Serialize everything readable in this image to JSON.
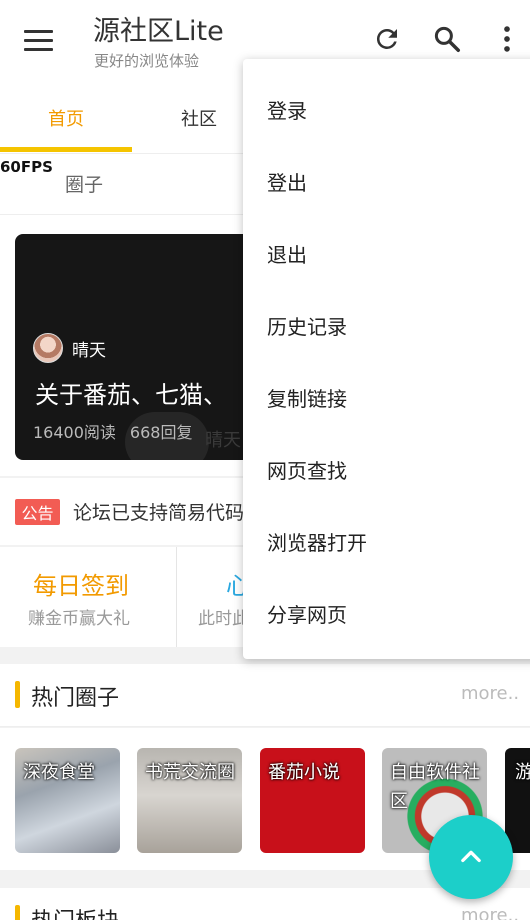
{
  "app": {
    "title": "源社区Lite",
    "subtitle": "更好的浏览体验",
    "icons": [
      "menu-icon",
      "refresh-icon",
      "search-icon",
      "more-vertical-icon"
    ]
  },
  "tabs": [
    {
      "label": "首页",
      "active": true
    },
    {
      "label": "社区",
      "active": false
    }
  ],
  "fps": "60FPS",
  "subtab": "圈子",
  "banner": {
    "author": "晴天",
    "title": "关于番茄、七猫、",
    "reads": "16400阅读",
    "replies": "668回复",
    "watermark": "晴天"
  },
  "notice": {
    "badge": "公告",
    "text": "论坛已支持简易代码"
  },
  "features": [
    {
      "title": "每日签到",
      "subtitle": "赚金币赢大礼",
      "color": "#f29a00"
    },
    {
      "title": "心",
      "subtitle": "此时此",
      "color": "#2aa8e0"
    }
  ],
  "hot_circles": {
    "title": "热门圈子",
    "more": "more..",
    "items": [
      {
        "label": "深夜食堂"
      },
      {
        "label": "书荒交流圈"
      },
      {
        "label": "番茄小说"
      },
      {
        "label": "自由软件社区"
      },
      {
        "label": "游"
      }
    ]
  },
  "hot_boards": {
    "title": "热门板块",
    "more": "more.."
  },
  "overflow_menu": [
    {
      "label": "登录"
    },
    {
      "label": "登出"
    },
    {
      "label": "退出"
    },
    {
      "label": "历史记录"
    },
    {
      "label": "复制链接"
    },
    {
      "label": "网页查找"
    },
    {
      "label": "浏览器打开"
    },
    {
      "label": "分享网页"
    }
  ],
  "colors": {
    "accent": "#f29a00",
    "tab_indicator": "#f5c400",
    "fab": "#1ccfc9",
    "notice_badge": "#f25c54"
  }
}
